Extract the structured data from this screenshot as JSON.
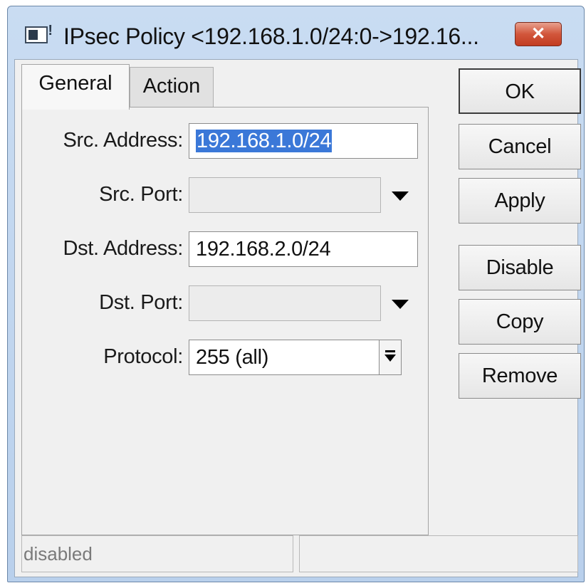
{
  "window": {
    "title": "IPsec Policy <192.168.1.0/24:0->192.16...",
    "close_label": "✕"
  },
  "tabs": [
    {
      "label": "General",
      "active": true
    },
    {
      "label": "Action",
      "active": false
    }
  ],
  "form": {
    "src_address": {
      "label": "Src. Address:",
      "value": "192.168.1.0/24",
      "selected": true
    },
    "src_port": {
      "label": "Src. Port:",
      "value": ""
    },
    "dst_address": {
      "label": "Dst. Address:",
      "value": "192.168.2.0/24"
    },
    "dst_port": {
      "label": "Dst. Port:",
      "value": ""
    },
    "protocol": {
      "label": "Protocol:",
      "value": "255 (all)"
    }
  },
  "buttons": {
    "ok": "OK",
    "cancel": "Cancel",
    "apply": "Apply",
    "disable": "Disable",
    "copy": "Copy",
    "remove": "Remove"
  },
  "status": {
    "left": "disabled",
    "right": ""
  },
  "icons": [
    "window-app-icon",
    "close-icon",
    "dropdown-arrow-icon",
    "combo-dropdown-icon"
  ],
  "colors": {
    "titlebar": "#c9dcf2",
    "close_button": "#d2563b",
    "selection": "#3b78d8"
  }
}
